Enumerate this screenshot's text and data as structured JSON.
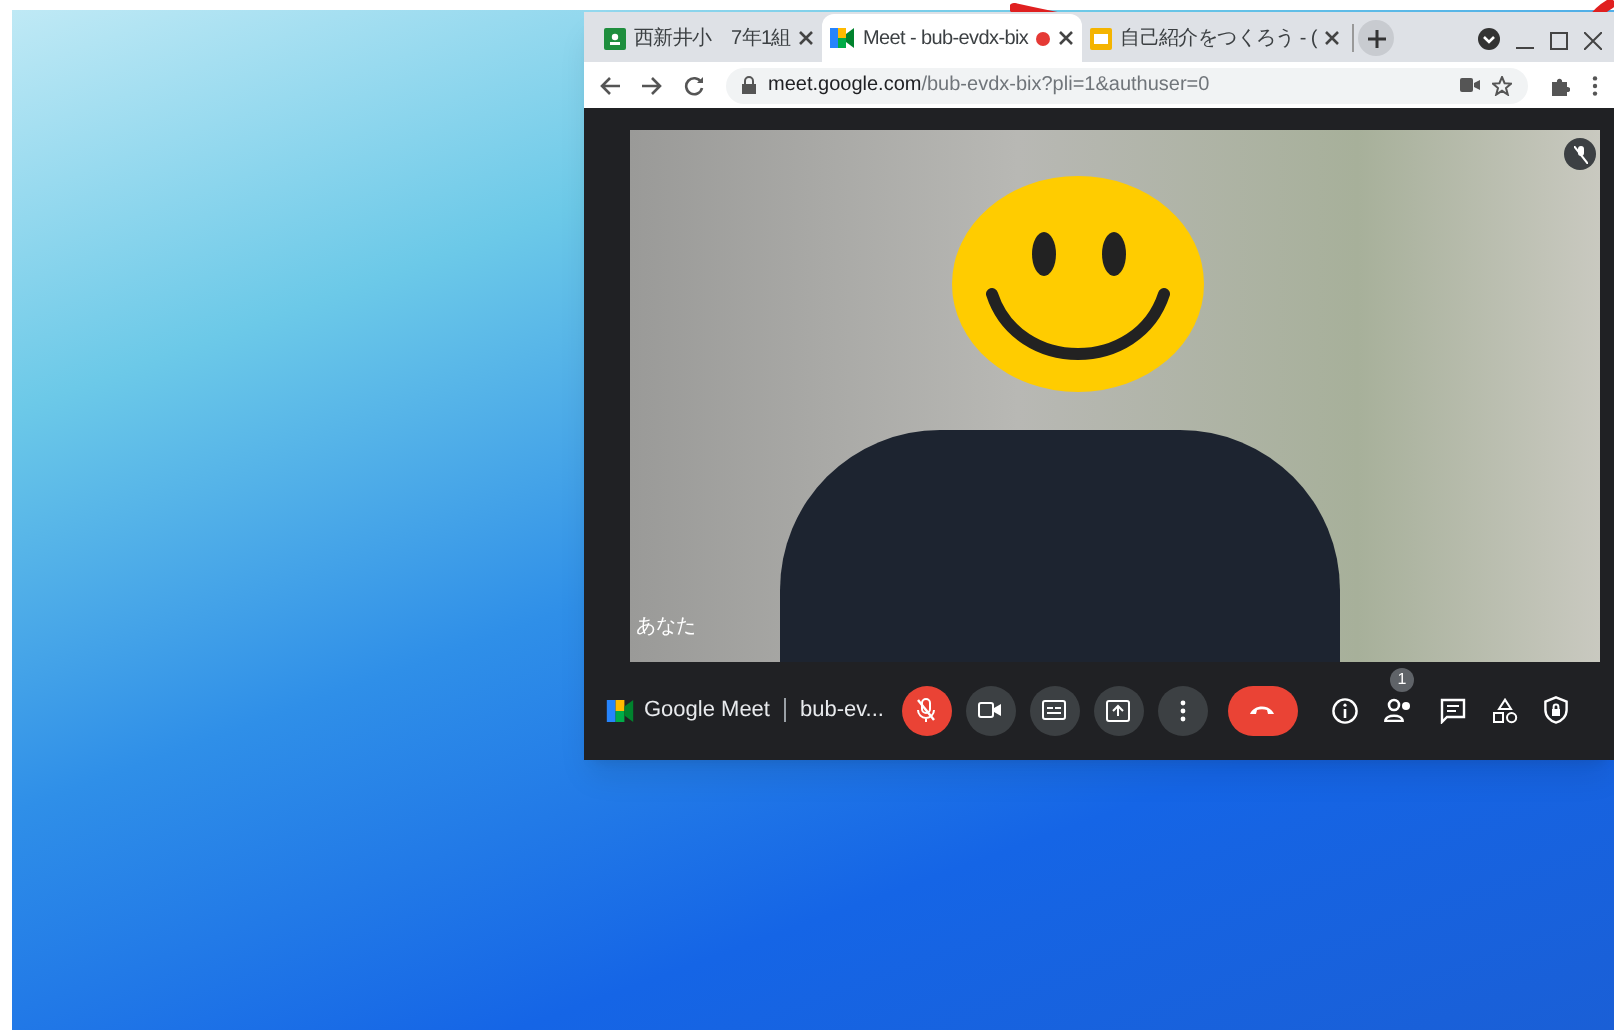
{
  "browser": {
    "tabs": [
      {
        "kind": "classroom",
        "title": "西新井小　7年1組",
        "selected": false,
        "recording": false
      },
      {
        "kind": "meet",
        "title": "Meet - bub-evdx-bix",
        "selected": true,
        "recording": true
      },
      {
        "kind": "slides",
        "title": "自己紹介をつくろう - (",
        "selected": false,
        "recording": false
      }
    ],
    "url_host": "meet.google.com",
    "url_path": "/bub-evdx-bix?pli=1&authuser=0"
  },
  "video": {
    "self_label": "あなた",
    "muted": true
  },
  "toolbar": {
    "brand": "Google Meet",
    "meeting_code": "bub-ev...",
    "mic_on": false,
    "camera_on": true,
    "captions_on": false,
    "participant_count": "1"
  }
}
